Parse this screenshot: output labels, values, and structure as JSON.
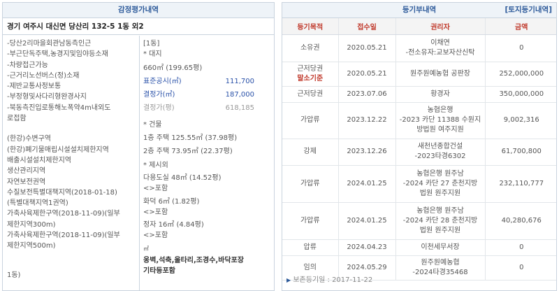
{
  "left": {
    "title": "감정평가내역",
    "address": "경기 여주시 대신면 당산리 132-5 1동 외2",
    "col1": [
      "-당산2리마을회관남동측인근",
      "-부근단독주택,농경지및임야등소재",
      "-차량접근가능",
      "-근거리노선버스(정)소재",
      "-제반교통사정보통",
      "-부정형및사다리형완경사지",
      "-북동측진입로통해노폭약4m내외도",
      "로접함",
      "(한강)수변구역",
      "(한강)폐기물매립시설설치제한지역",
      "배출시설설치제한지역",
      "생산관리지역",
      "자연보전권역",
      "수질보전특별대책지역(2018-01-18)",
      "(특별대책지역1권역)",
      "가축사육제한구역(2018-11-09)(일부",
      "제한지역300m)",
      "가축사육제한구역(2018-11-09)(일부",
      "제한지역500m)",
      "1동)"
    ],
    "col2": {
      "bldg_no": "[1동]",
      "land_label": "* 대지",
      "land_area": "660㎡ (199.65평)",
      "official_label": "표준공시(㎡)",
      "official_value": "111,700",
      "appraisal_label": "결정가(㎡)",
      "appraisal_value": "187,000",
      "pyeong_label": "결정가(평)",
      "pyeong_value": "618,185",
      "building_label": "* 건물",
      "bldg1": "1층 주택 125.55㎡ (37.98평)",
      "bldg2": "2층 주택 73.95㎡ (22.37평)",
      "exclude_label": "* 제시외",
      "ex1": "다용도실 48㎡ (14.52평)",
      "ex1_incl": "<>포함",
      "ex2": "화덕 6㎡ (1.82평)",
      "ex2_incl": "<>포함",
      "ex3": "정자 16㎡ (4.84평)",
      "ex3_incl": "<>포함",
      "unit": "㎡",
      "bold1": "옹벽,석축,울타리,조경수,바닥포장",
      "bold2": "기타등포함"
    }
  },
  "right": {
    "title": "등기부내역",
    "link": "[토지등기내역]",
    "headers": [
      "등기목적",
      "접수일",
      "권리자",
      "금액"
    ],
    "rows": [
      {
        "purpose": "소유권",
        "date": "2020.05.21",
        "holder": [
          "이채연",
          "-전소유자:교보자산신탁"
        ],
        "amount": "0"
      },
      {
        "purpose": "근저당권",
        "purpose_note": "말소기준",
        "date": "2020.05.21",
        "holder": [
          "원주원예농협 공판장"
        ],
        "amount": "252,000,000"
      },
      {
        "purpose": "근저당권",
        "date": "2023.07.06",
        "holder": [
          "황경자"
        ],
        "amount": "350,000,000"
      },
      {
        "purpose": "가압류",
        "date": "2023.12.22",
        "holder": [
          "농협은행",
          "-2023 카단 11388 수원지",
          "방법원 여주지원"
        ],
        "amount": "9,002,316"
      },
      {
        "purpose": "강제",
        "date": "2023.12.26",
        "holder": [
          "새천년종합건설",
          "-2023타경6302"
        ],
        "amount": "61,700,800"
      },
      {
        "purpose": "가압류",
        "date": "2024.01.25",
        "holder": [
          "농협은행 원주남",
          "-2024 카단 27 춘천지방",
          "법원 원주지원"
        ],
        "amount": "232,110,777"
      },
      {
        "purpose": "가압류",
        "date": "2024.01.25",
        "holder": [
          "농협은행 원주남",
          "-2024 카단 28 춘천지방",
          "법원 원주지원"
        ],
        "amount": "40,280,676"
      },
      {
        "purpose": "압류",
        "date": "2024.04.23",
        "holder": [
          "이천세무서장"
        ],
        "amount": "0"
      },
      {
        "purpose": "임의",
        "date": "2024.05.29",
        "holder": [
          "원주원예농협",
          "-2024타경35468"
        ],
        "amount": "0"
      }
    ],
    "footer": "보존등기일 : 2017-11-22"
  }
}
